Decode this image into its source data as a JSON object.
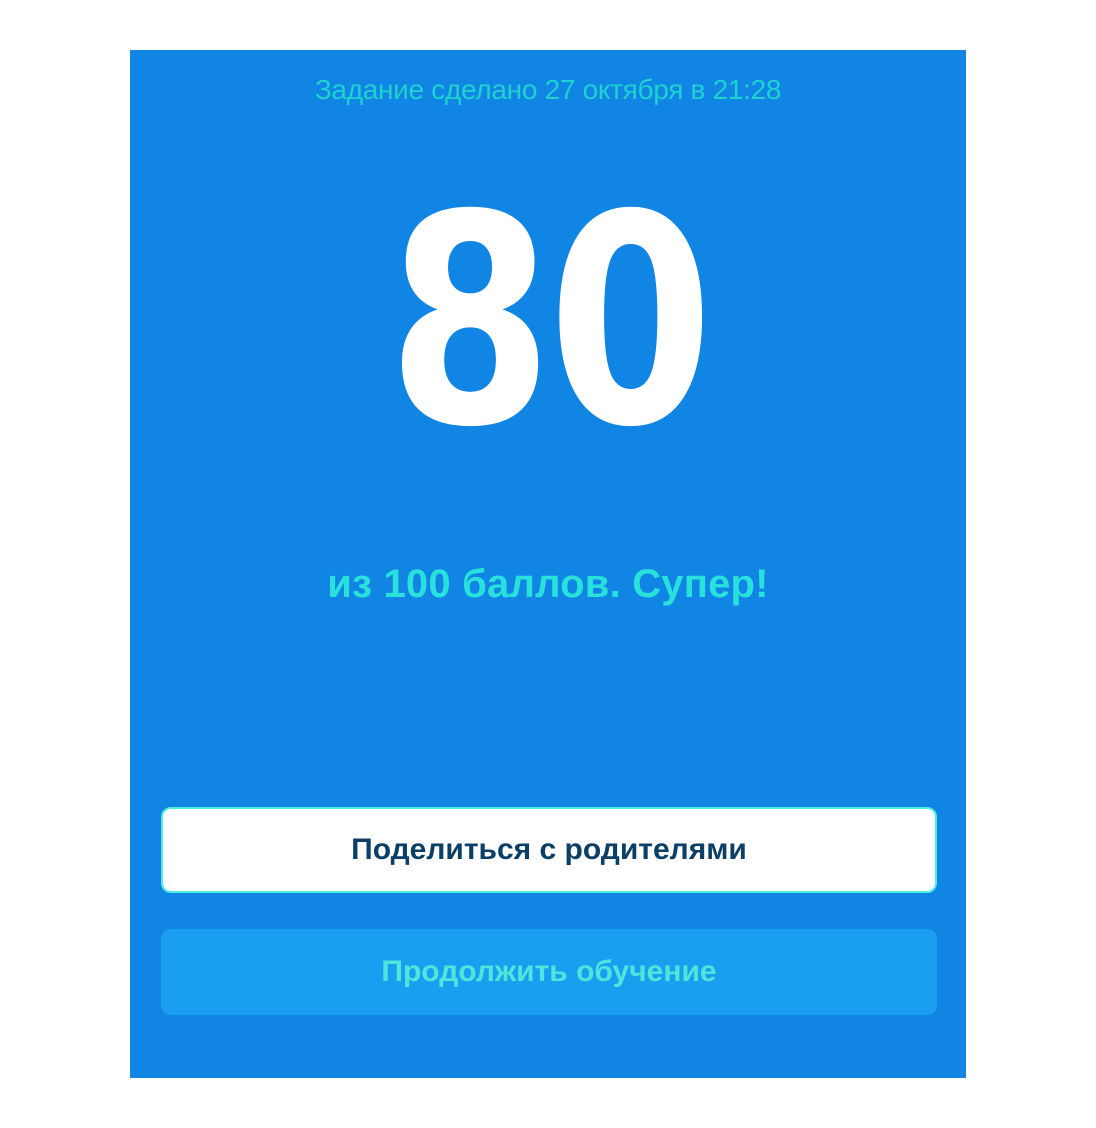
{
  "result": {
    "completed_text": "Задание сделано 27 октября в 21:28",
    "score": "80",
    "subtitle": "из 100 баллов. Супер!"
  },
  "actions": {
    "share_label": "Поделиться с родителями",
    "continue_label": "Продолжить обучение"
  },
  "colors": {
    "background": "#1185e4",
    "accent": "#28e1dc",
    "button_dark_text": "#0b3f66"
  }
}
